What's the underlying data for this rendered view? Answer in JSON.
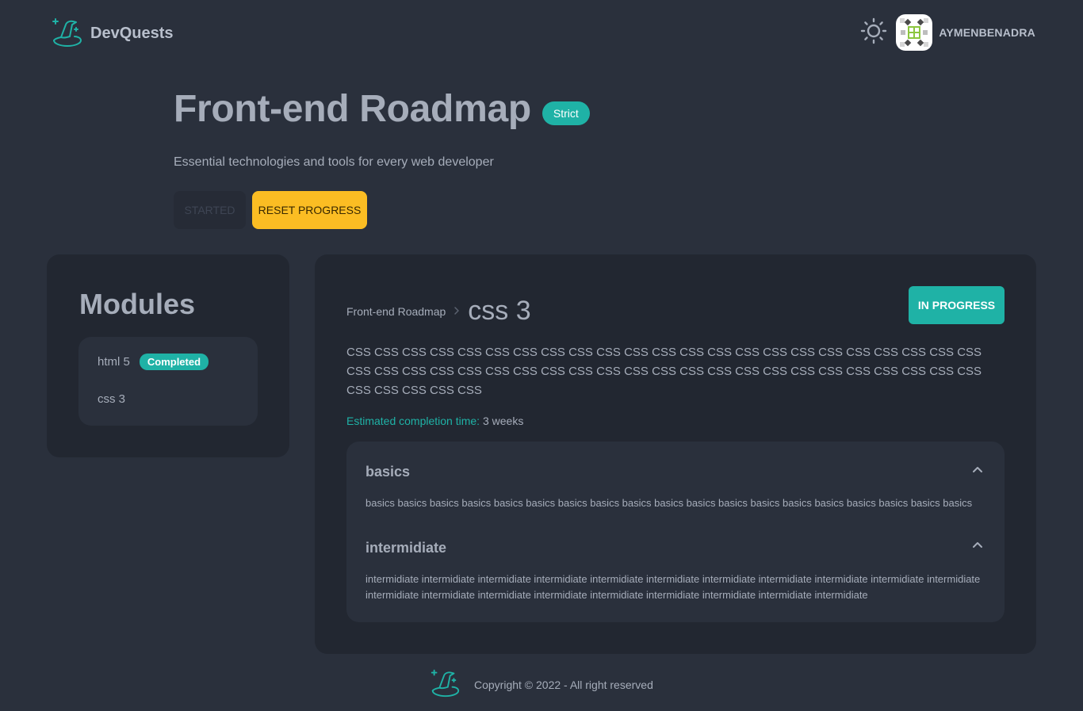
{
  "header": {
    "brand": "DevQuests",
    "username": "AYMENBENADRA"
  },
  "hero": {
    "title": "Front-end Roadmap",
    "badge": "Strict",
    "subtitle": "Essential technologies and tools for every web developer",
    "started_label": "STARTED",
    "reset_label": "RESET PROGRESS"
  },
  "modules": {
    "title": "Modules",
    "items": [
      {
        "label": "html 5",
        "badge": "Completed"
      },
      {
        "label": "css 3"
      }
    ]
  },
  "main": {
    "breadcrumb_parent": "Front-end Roadmap",
    "breadcrumb_current": "css 3",
    "status_label": "IN PROGRESS",
    "description": "CSS CSS CSS CSS CSS CSS CSS CSS CSS CSS CSS CSS CSS CSS CSS CSS CSS CSS CSS CSS CSS CSS CSS CSS CSS CSS CSS CSS CSS CSS CSS CSS CSS CSS CSS CSS CSS CSS CSS CSS CSS CSS CSS CSS CSS CSS CSS CSS CSS CSS CSS",
    "estimate_label": "Estimated completion time:",
    "estimate_value": "3 weeks",
    "sections": [
      {
        "title": "basics",
        "body": "basics basics basics basics basics basics basics basics basics basics basics basics basics basics basics basics basics basics basics"
      },
      {
        "title": "intermidiate",
        "body": "intermidiate intermidiate intermidiate intermidiate intermidiate intermidiate intermidiate intermidiate intermidiate intermidiate intermidiate intermidiate intermidiate intermidiate intermidiate intermidiate intermidiate intermidiate intermidiate intermidiate"
      }
    ]
  },
  "footer": {
    "copyright": "Copyright © 2022 - All right reserved"
  },
  "colors": {
    "background": "#2a303c",
    "panel": "#222731",
    "accent": "#1fb2a6",
    "warning": "#fbbd23",
    "text": "#a6adba"
  },
  "icons": {
    "brand": "wizard-hat-icon",
    "theme": "sun-icon",
    "chevron": "chevron-up-icon"
  }
}
